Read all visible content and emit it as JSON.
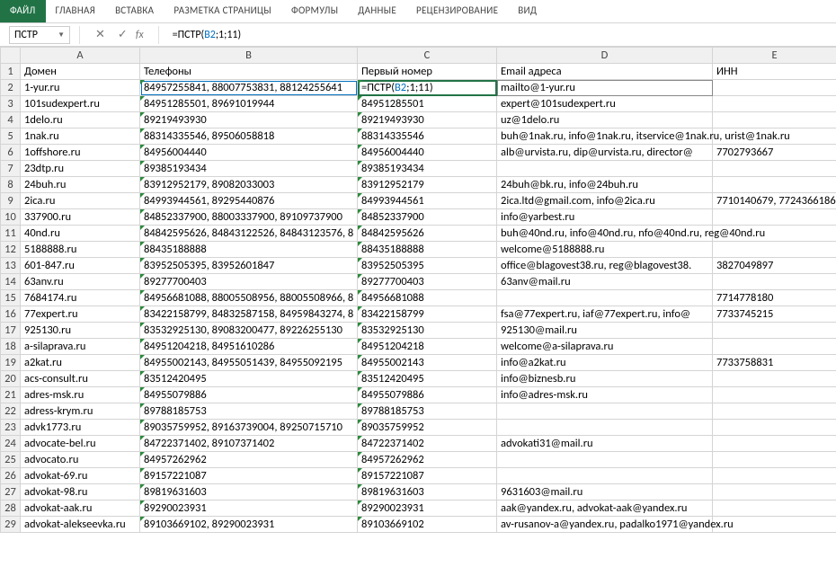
{
  "ribbon": {
    "file": "ФАЙЛ",
    "tabs": [
      "ГЛАВНАЯ",
      "ВСТАВКА",
      "РАЗМЕТКА СТРАНИЦЫ",
      "ФОРМУЛЫ",
      "ДАННЫЕ",
      "РЕЦЕНЗИРОВАНИЕ",
      "ВИД"
    ]
  },
  "name_box": "ПСТР",
  "formula_prefix": "=ПСТР(",
  "formula_ref": "B2",
  "formula_suffix": ";1;11)",
  "cols": [
    "A",
    "B",
    "C",
    "D",
    "E"
  ],
  "headers": {
    "A": "Домен",
    "B": "Телефоны",
    "C": "Первый номер",
    "D": "Email адреса",
    "E": "ИНН"
  },
  "cell_prefix": "=ПСТР(",
  "cell_ref": "B2",
  "cell_suffix": ";1;11)",
  "rows": [
    {
      "n": 2,
      "A": "1-yur.ru",
      "B": "84957255841, 88007753831, 88124255641",
      "D": "mailto@1-yur.ru",
      "E": ""
    },
    {
      "n": 3,
      "A": "101sudexpert.ru",
      "B": "84951285501, 89691019944",
      "C": "84951285501",
      "D": "expert@101sudexpert.ru",
      "E": ""
    },
    {
      "n": 4,
      "A": "1delo.ru",
      "B": "89219493930",
      "C": "89219493930",
      "D": "uz@1delo.ru",
      "E": ""
    },
    {
      "n": 5,
      "A": "1nak.ru",
      "B": "88314335546, 89506058818",
      "C": "88314335546",
      "D": "buh@1nak.ru, info@1nak.ru, itservice@1nak.ru, urist@1nak.ru",
      "E": "",
      "Dover": true
    },
    {
      "n": 6,
      "A": "1offshore.ru",
      "B": "84956004440",
      "C": "84956004440",
      "D": "alb@urvista.ru, dip@urvista.ru, director@",
      "E": "7702793667"
    },
    {
      "n": 7,
      "A": "23dtp.ru",
      "B": "89385193434",
      "C": "89385193434",
      "D": "",
      "E": ""
    },
    {
      "n": 8,
      "A": "24buh.ru",
      "B": "83912952179, 89082033003",
      "C": "83912952179",
      "D": "24buh@bk.ru, info@24buh.ru",
      "E": ""
    },
    {
      "n": 9,
      "A": "2ica.ru",
      "B": "84993944561, 89295440876",
      "C": "84993944561",
      "D": "2ica.ltd@gmail.com, info@2ica.ru",
      "E": "7710140679, 7724366186"
    },
    {
      "n": 10,
      "A": "337900.ru",
      "B": "84852337900, 88003337900, 89109737900",
      "C": "84852337900",
      "D": "info@yarbest.ru",
      "E": ""
    },
    {
      "n": 11,
      "A": "40nd.ru",
      "B": "84842595626, 84843122526, 84843123576, 8",
      "C": "84842595626",
      "D": "buh@40nd.ru, info@40nd.ru, nfo@40nd.ru, reg@40nd.ru",
      "E": "",
      "Dover": true
    },
    {
      "n": 12,
      "A": "5188888.ru",
      "B": "88435188888",
      "C": "88435188888",
      "D": "welcome@5188888.ru",
      "E": ""
    },
    {
      "n": 13,
      "A": "601-847.ru",
      "B": "83952505395, 83952601847",
      "C": "83952505395",
      "D": "office@blagovest38.ru, reg@blagovest38.",
      "E": "3827049897"
    },
    {
      "n": 14,
      "A": "63anv.ru",
      "B": "89277700403",
      "C": "89277700403",
      "D": "63anv@mail.ru",
      "E": ""
    },
    {
      "n": 15,
      "A": "7684174.ru",
      "B": "84956681088, 88005508956, 88005508966, 8",
      "C": "84956681088",
      "D": "",
      "E": "7714778180"
    },
    {
      "n": 16,
      "A": "77expert.ru",
      "B": "83422158799, 84832587158, 84959843274, 8",
      "C": "83422158799",
      "D": "fsa@77expert.ru, iaf@77expert.ru, info@",
      "E": "7733745215"
    },
    {
      "n": 17,
      "A": "925130.ru",
      "B": "83532925130, 89083200477, 89226255130",
      "C": "83532925130",
      "D": "925130@mail.ru",
      "E": ""
    },
    {
      "n": 18,
      "A": "a-silaprava.ru",
      "B": "84951204218, 84951610286",
      "C": "84951204218",
      "D": "welcome@a-silaprava.ru",
      "E": ""
    },
    {
      "n": 19,
      "A": "a2kat.ru",
      "B": "84955002143, 84955051439, 84955092195",
      "C": "84955002143",
      "D": "info@a2kat.ru",
      "E": "7733758831"
    },
    {
      "n": 20,
      "A": "acs-consult.ru",
      "B": "83512420495",
      "C": "83512420495",
      "D": "info@biznesb.ru",
      "E": ""
    },
    {
      "n": 21,
      "A": "adres-msk.ru",
      "B": "84955079886",
      "C": "84955079886",
      "D": "info@adres-msk.ru",
      "E": ""
    },
    {
      "n": 22,
      "A": "adress-krym.ru",
      "B": "89788185753",
      "C": "89788185753",
      "D": "",
      "E": ""
    },
    {
      "n": 23,
      "A": "advk1773.ru",
      "B": "89035759952, 89163739004, 89250715710",
      "C": "89035759952",
      "D": "",
      "E": ""
    },
    {
      "n": 24,
      "A": "advocate-bel.ru",
      "B": "84722371402, 89107371402",
      "C": "84722371402",
      "D": "advokati31@mail.ru",
      "E": ""
    },
    {
      "n": 25,
      "A": "advocato.ru",
      "B": "84957262962",
      "C": "84957262962",
      "D": "",
      "E": ""
    },
    {
      "n": 26,
      "A": "advokat-69.ru",
      "B": "89157221087",
      "C": "89157221087",
      "D": "",
      "E": ""
    },
    {
      "n": 27,
      "A": "advokat-98.ru",
      "B": "89819631603",
      "C": "89819631603",
      "D": "9631603@mail.ru",
      "E": ""
    },
    {
      "n": 28,
      "A": "advokat-aak.ru",
      "B": "89290023931",
      "C": "89290023931",
      "D": "aak@yandex.ru, advokat-aak@yandex.ru",
      "E": ""
    },
    {
      "n": 29,
      "A": "advokat-alekseevka.ru",
      "B": "89103669102, 89290023931",
      "C": "89103669102",
      "D": "av-rusanov-a@yandex.ru, padalko1971@yandex.ru",
      "E": "",
      "Dover": true
    }
  ]
}
